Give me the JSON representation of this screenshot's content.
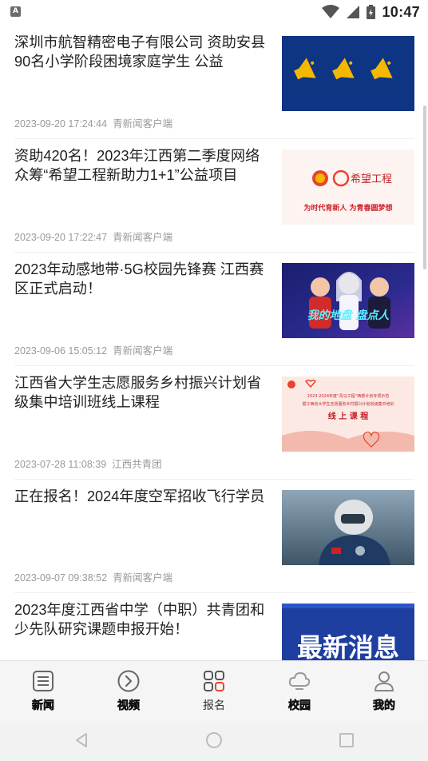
{
  "status_bar": {
    "time": "10:47",
    "app_badge": "A"
  },
  "news": [
    {
      "title": "深圳市航智精密电子有限公司 资助安县90名小学阶段困境家庭学生 公益",
      "date": "2023-09-20 17:24:44",
      "source": "青新闻客户端",
      "thumb": "megaphones"
    },
    {
      "title": "资助420名！2023年江西第二季度网络众筹“希望工程新助力1+1”公益项目",
      "date": "2023-09-20 17:22:47",
      "source": "青新闻客户端",
      "thumb": "hope-project",
      "thumb_text": "为时代育新人  为青春圆梦想",
      "thumb_logo": "希望工程"
    },
    {
      "title": "2023年动感地带·5G校园先锋赛 江西赛区正式启动！",
      "date": "2023-09-06 15:05:12",
      "source": "青新闻客户端",
      "thumb": "esports",
      "thumb_text": "我的地盘 盘点人"
    },
    {
      "title": "江西省大学生志愿服务乡村振兴计划省级集中培训班线上课程",
      "date": "2023-07-28 11:08:39",
      "source": "江西共青团",
      "thumb": "training",
      "thumb_text_1": "2023-2024年度“青马工程”西部计划专项示范",
      "thumb_text_2": "暨江西省大学生志愿服务乡村振兴计划省级集中培训",
      "thumb_text_3": "线 上 课 程"
    },
    {
      "title": "正在报名！2024年度空军招收飞行学员",
      "date": "2023-09-07 09:38:52",
      "source": "青新闻客户端",
      "thumb": "pilot"
    },
    {
      "title": "2023年度江西省中学（中职）共青团和少先队研究课题申报开始！",
      "date": "",
      "source": "",
      "thumb": "latest-news",
      "thumb_text": "最新消息"
    }
  ],
  "bottom_nav": [
    {
      "label": "新闻",
      "icon": "news-icon"
    },
    {
      "label": "视频",
      "icon": "play-icon"
    },
    {
      "label": "报名",
      "icon": "grid-icon",
      "active": true
    },
    {
      "label": "校园",
      "icon": "cloud-icon"
    },
    {
      "label": "我的",
      "icon": "user-icon"
    }
  ],
  "colors": {
    "accent_red": "#e8432e",
    "meta_gray": "#9a9a9a",
    "news_blue": "#1e3fa0"
  }
}
